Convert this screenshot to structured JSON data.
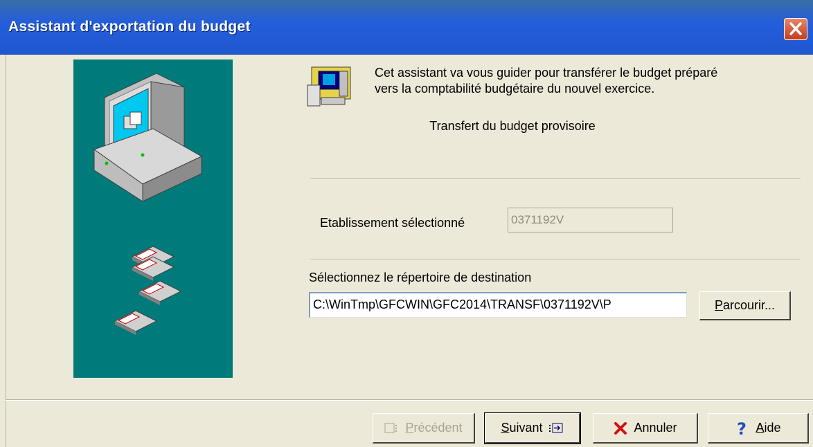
{
  "window": {
    "title": "Assistant d'exportation du budget"
  },
  "intro": {
    "line1": "Cet assistant va vous guider pour transférer le budget préparé",
    "line2": "vers la comptabilité budgétaire du nouvel exercice.",
    "subtitle": "Transfert du budget provisoire"
  },
  "establishment": {
    "label": "Etablissement sélectionné",
    "value": "0371192V"
  },
  "destination": {
    "label": "Sélectionnez le répertoire de destination",
    "path": "C:\\WinTmp\\GFCWIN\\GFC2014\\TRANSF\\0371192V\\P",
    "browse_label_mn": "P",
    "browse_label_rest": "arcourir..."
  },
  "buttons": {
    "previous_mn": "P",
    "previous_rest": "récédent",
    "next_mn": "S",
    "next_rest": "uivant",
    "cancel": "Annuler",
    "help_mn": "A",
    "help_rest": "ide"
  },
  "colors": {
    "titlebar": "#245edb",
    "panel": "#007a7a",
    "background": "#ece9d8"
  }
}
